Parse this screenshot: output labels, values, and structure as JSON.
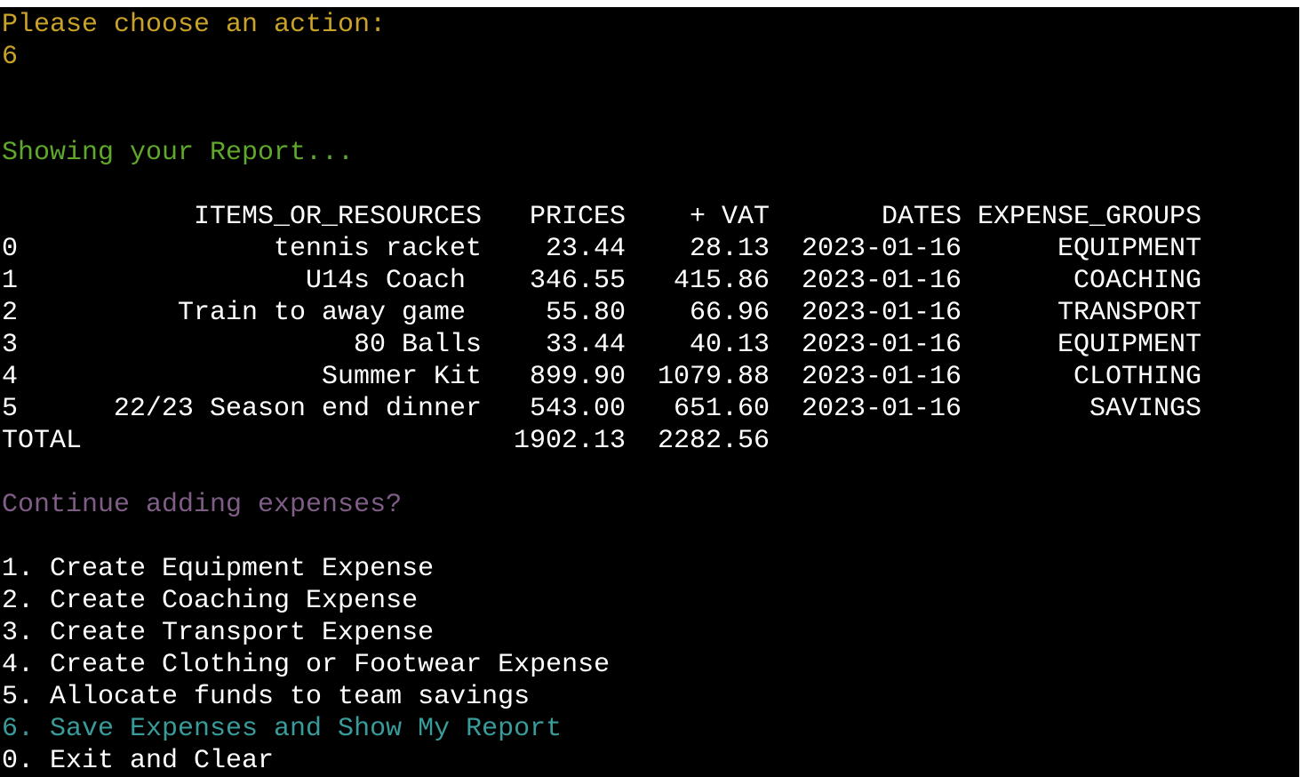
{
  "prompt": {
    "text": "Please choose an action:",
    "input_value": "6"
  },
  "status": {
    "text": "Showing your Report..."
  },
  "report": {
    "headers": {
      "items": "ITEMS_OR_RESOURCES",
      "prices": "PRICES",
      "vat": "+ VAT",
      "dates": "DATES",
      "groups": "EXPENSE_GROUPS"
    },
    "rows": [
      {
        "index": "0",
        "item": "tennis racket",
        "price": "23.44",
        "vat": "28.13",
        "date": "2023-01-16",
        "group": "EQUIPMENT"
      },
      {
        "index": "1",
        "item": "U14s Coach ",
        "price": "346.55",
        "vat": "415.86",
        "date": "2023-01-16",
        "group": "COACHING"
      },
      {
        "index": "2",
        "item": "Train to away game ",
        "price": "55.80",
        "vat": "66.96",
        "date": "2023-01-16",
        "group": "TRANSPORT"
      },
      {
        "index": "3",
        "item": "80 Balls",
        "price": "33.44",
        "vat": "40.13",
        "date": "2023-01-16",
        "group": "EQUIPMENT"
      },
      {
        "index": "4",
        "item": "Summer Kit",
        "price": "899.90",
        "vat": "1079.88",
        "date": "2023-01-16",
        "group": "CLOTHING"
      },
      {
        "index": "5",
        "item": "22/23 Season end dinner",
        "price": "543.00",
        "vat": "651.60",
        "date": "2023-01-16",
        "group": "SAVINGS"
      }
    ],
    "total": {
      "label": "TOTAL",
      "price": "1902.13",
      "vat": "2282.56"
    }
  },
  "continue_prompt": {
    "text": "Continue adding expenses?"
  },
  "menu": {
    "items": [
      {
        "label": "1. Create Equipment Expense"
      },
      {
        "label": "2. Create Coaching Expense"
      },
      {
        "label": "3. Create Transport Expense"
      },
      {
        "label": "4. Create Clothing or Footwear Expense"
      },
      {
        "label": "5. Allocate funds to team savings"
      },
      {
        "label": "6. Save Expenses and Show My Report"
      },
      {
        "label": "0. Exit and Clear"
      }
    ]
  },
  "colors": {
    "background": "#000000",
    "prompt": "#c9a227",
    "status": "#5fa82b",
    "continue": "#7f5d86",
    "selected_menu": "#3a9b9b",
    "text": "#ffffff"
  }
}
